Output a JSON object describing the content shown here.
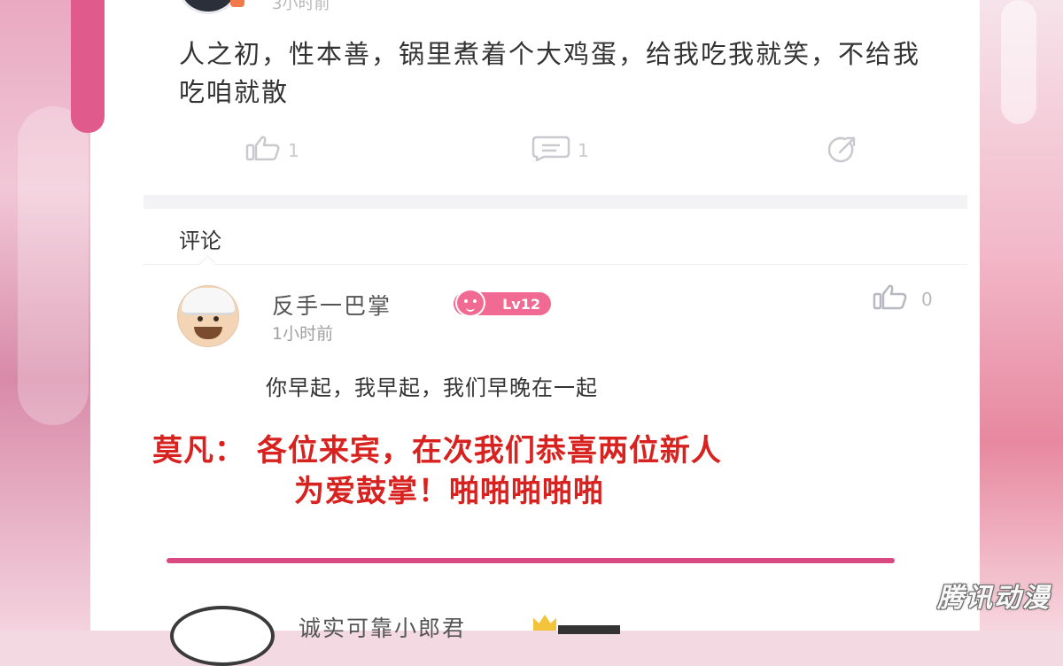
{
  "post": {
    "time": "3小时前",
    "text": "人之初，性本善，锅里煮着个大鸡蛋，给我吃我就笑，不给我吃咱就散",
    "like_count": "1",
    "comment_count": "1"
  },
  "comments_section": {
    "title": "评论"
  },
  "comment": {
    "user_name": "反手一巴掌",
    "level": "Lv12",
    "time": "1小时前",
    "like_count": "0",
    "text": "你早起，我早起，我们早晚在一起"
  },
  "caption": {
    "line1": "莫凡： 各位来宾，在次我们恭喜两位新人",
    "line2": "为爱鼓掌！啪啪啪啪啪"
  },
  "next_comment": {
    "user_name": "诚实可靠小郎君"
  },
  "watermark": "腾讯动漫",
  "colors": {
    "accent_pink": "#e05a8c",
    "caption_red": "#d8221f",
    "level_badge": "#f06a93"
  },
  "icons": [
    "thumbs-up-icon",
    "comment-bubble-icon",
    "share-icon"
  ]
}
